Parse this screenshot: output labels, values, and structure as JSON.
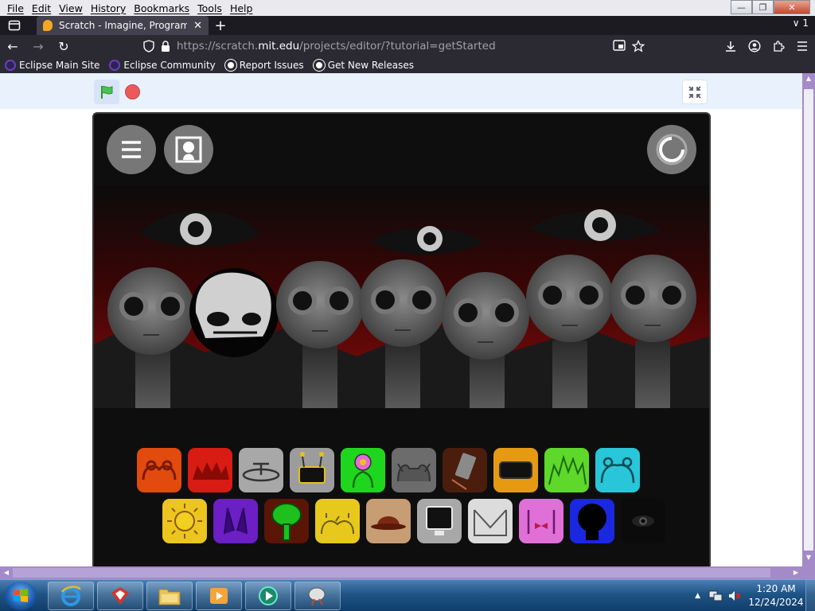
{
  "menu": [
    "File",
    "Edit",
    "View",
    "History",
    "Bookmarks",
    "Tools",
    "Help"
  ],
  "window_controls": {
    "minimize": "—",
    "restore": "❐",
    "close": "✕"
  },
  "tab": {
    "title": "Scratch - Imagine, Program, Sha",
    "close": "✕",
    "new": "+"
  },
  "tab_overflow": "∨ 1",
  "nav": {
    "back": "←",
    "forward": "→",
    "reload": "↻",
    "url_prefix": "https://scratch.",
    "url_domain": "mit.edu",
    "url_path": "/projects/editor/?tutorial=getStarted"
  },
  "bookmarks": [
    {
      "label": "Eclipse Main Site",
      "icon": "eclipse-icon",
      "color": "#2c2255"
    },
    {
      "label": "Eclipse Community",
      "icon": "eclipse-icon",
      "color": "#2c2255"
    },
    {
      "label": "Report Issues",
      "icon": "github-icon",
      "color": "#ffffff"
    },
    {
      "label": "Get New Releases",
      "icon": "github-icon",
      "color": "#ffffff"
    }
  ],
  "stage_toolbar": {
    "green_flag": "green-flag-icon",
    "stop": "stop-icon",
    "fullscreen": "unfullscreen-icon"
  },
  "project_controls": {
    "menu": "menu-icon",
    "portrait": "portrait-icon",
    "reset": "reset-icon"
  },
  "sound_icons_row1": [
    {
      "name": "orange-arcs",
      "bg": "#e24a0e"
    },
    {
      "name": "red-spikes",
      "bg": "#d81c14"
    },
    {
      "name": "grey-lamp",
      "bg": "#a8a8a8"
    },
    {
      "name": "grey-tv-antennae",
      "bg": "#9c9c9c"
    },
    {
      "name": "green-flower",
      "bg": "#1fd61f"
    },
    {
      "name": "grey-ears",
      "bg": "#6c6c6c"
    },
    {
      "name": "brown-phone",
      "bg": "#4b1d0c"
    },
    {
      "name": "orange-visor",
      "bg": "#e69a12"
    },
    {
      "name": "green-grass",
      "bg": "#5ed82a"
    },
    {
      "name": "cyan-bear",
      "bg": "#28c6d8"
    }
  ],
  "sound_icons_row2": [
    {
      "name": "yellow-sun",
      "bg": "#ecc51e"
    },
    {
      "name": "purple-horns",
      "bg": "#6b1fc4"
    },
    {
      "name": "green-tree",
      "bg": "#5a1506"
    },
    {
      "name": "yellow-arcs",
      "bg": "#e8c81c"
    },
    {
      "name": "tan-hat",
      "bg": "#c79d74"
    },
    {
      "name": "grey-monitor",
      "bg": "#a8a8a8"
    },
    {
      "name": "white-envelope",
      "bg": "#dcdcdc"
    },
    {
      "name": "pink-bow",
      "bg": "#e070d8"
    },
    {
      "name": "blue-shadow",
      "bg": "#1a28e0"
    },
    {
      "name": "black-eye",
      "bg": "#0b0b0b"
    }
  ],
  "taskbar": {
    "apps": [
      "internet-explorer-icon",
      "foxit-icon",
      "folder-icon",
      "media-player-icon",
      "media-center-icon",
      "scratch-app-icon"
    ]
  },
  "clock": {
    "time": "1:20 AM",
    "date": "12/24/2024"
  },
  "colors": {
    "browser_dark": "#2b2a33",
    "stage_red": "#7a0b0b",
    "scrollbar": "#a48ac8"
  }
}
